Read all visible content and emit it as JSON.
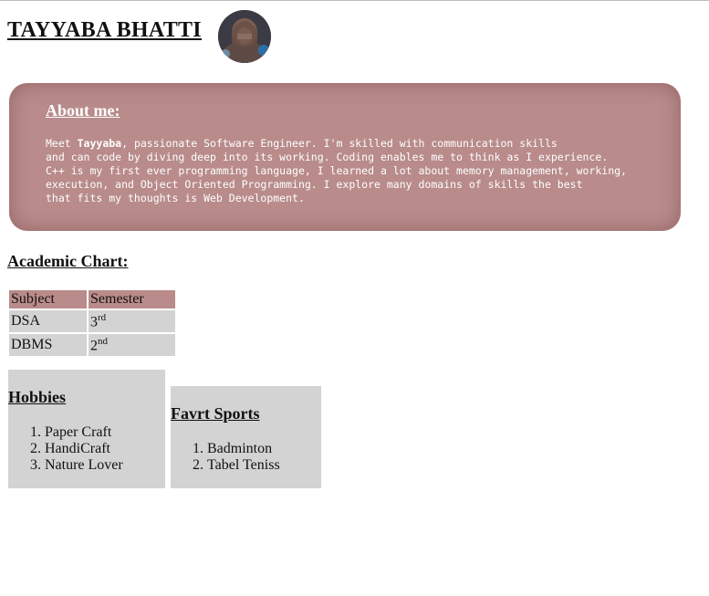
{
  "header": {
    "name": "TAYYABA BHATTI",
    "avatar_icon": "profile-photo"
  },
  "about": {
    "title": "About me:",
    "line1_pre": "Meet ",
    "line1_bold": "Tayyaba",
    "line1_post": ", passionate Software Engineer. I'm skilled with communication skills",
    "line2": "and can code by diving deep into its working. Coding enables me to think as I experience.",
    "line3": "C++ is my first ever programming language, I learned a lot about memory management, working,",
    "line4": "execution, and Object Oriented Programming. I explore many domains of skills the best",
    "line5": "that fits my thoughts is Web Development."
  },
  "academic": {
    "title": "Academic Chart:",
    "headers": [
      "Subject",
      "Semester"
    ],
    "rows": [
      {
        "subject": "DSA",
        "semester_num": "3",
        "semester_suffix": "rd"
      },
      {
        "subject": "DBMS",
        "semester_num": "2",
        "semester_suffix": "nd"
      }
    ]
  },
  "hobbies": {
    "title": "Hobbies",
    "items": [
      "Paper Craft",
      "HandiCraft",
      "Nature Lover"
    ]
  },
  "sports": {
    "title": "Favrt Sports",
    "items": [
      "Badminton",
      "Tabel Teniss"
    ]
  },
  "colors": {
    "accent": "#b98b8b",
    "box_gray": "#d3d3d3"
  }
}
